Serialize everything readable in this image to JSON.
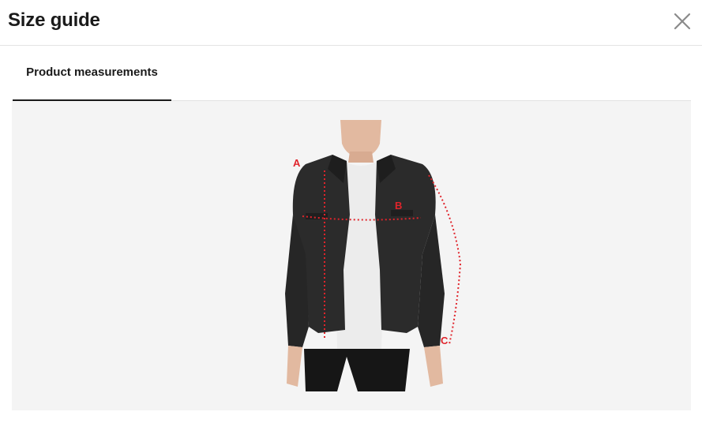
{
  "modal": {
    "title": "Size guide",
    "close_icon": "close-icon"
  },
  "tabs": [
    {
      "label": "Product measurements",
      "active": true
    }
  ],
  "figure": {
    "labels": {
      "a": "A",
      "b": "B",
      "c": "C"
    },
    "colors": {
      "measure": "#e0242b",
      "jacket": "#2b2b2b",
      "panel": "#f4f4f4"
    }
  }
}
